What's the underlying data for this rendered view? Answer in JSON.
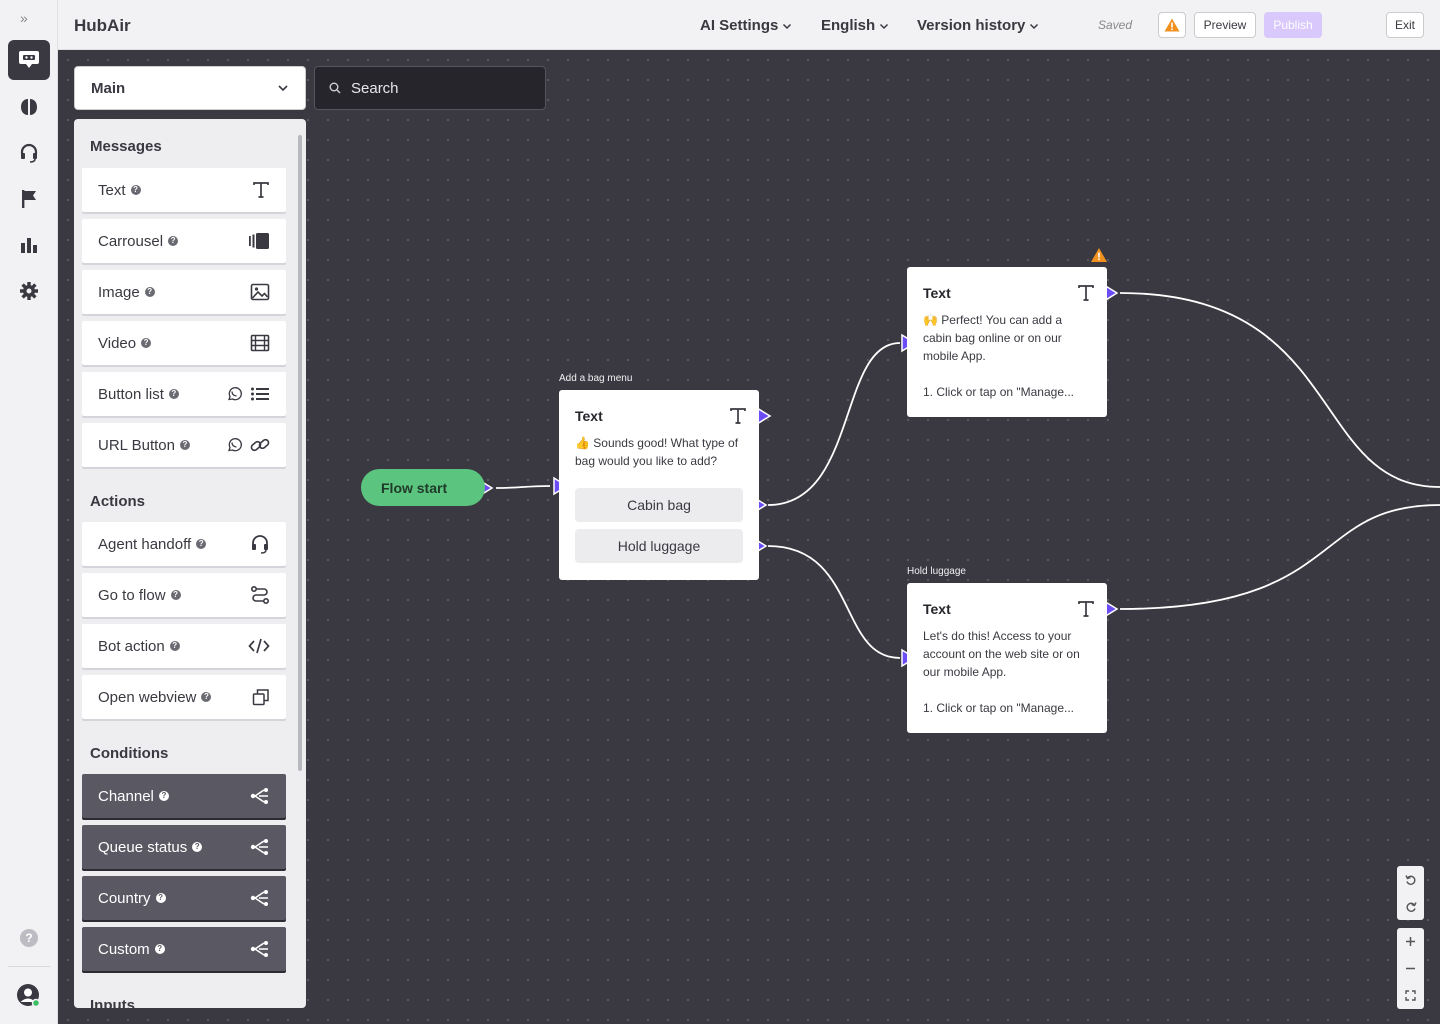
{
  "app": {
    "title": "HubAir"
  },
  "header": {
    "ai_settings": "AI Settings",
    "language": "English",
    "version_history": "Version history",
    "status": "Saved",
    "preview": "Preview",
    "publish": "Publish",
    "exit": "Exit"
  },
  "flow_select": {
    "value": "Main"
  },
  "search": {
    "placeholder": "Search"
  },
  "palette": {
    "messages_title": "Messages",
    "messages": [
      "Text",
      "Carrousel",
      "Image",
      "Video",
      "Button list",
      "URL Button"
    ],
    "actions_title": "Actions",
    "actions": [
      "Agent handoff",
      "Go to flow",
      "Bot action",
      "Open webview"
    ],
    "conditions_title": "Conditions",
    "conditions": [
      "Channel",
      "Queue status",
      "Country",
      "Custom"
    ],
    "inputs_title": "Inputs"
  },
  "canvas": {
    "flow_start": "Flow start",
    "node_menu": {
      "caption": "Add a bag menu",
      "title": "Text",
      "body": "👍 Sounds good! What type of bag would you like to add?",
      "choices": [
        "Cabin bag",
        "Hold luggage"
      ]
    },
    "node_cabin": {
      "title": "Text",
      "body_1": "🙌 Perfect! You can add a cabin bag online or on our mobile App.",
      "body_2": "1. Click or tap on \"Manage..."
    },
    "node_hold": {
      "caption": "Hold luggage",
      "title": "Text",
      "body_1": "Let's do this! Access to your account on the web site or on our mobile App.",
      "body_2": "1. Click or tap on \"Manage..."
    }
  },
  "colors": {
    "accent": "#6b4cf6",
    "start": "#5bc47e",
    "warning": "#f0901e",
    "canvas": "#3a3941"
  }
}
